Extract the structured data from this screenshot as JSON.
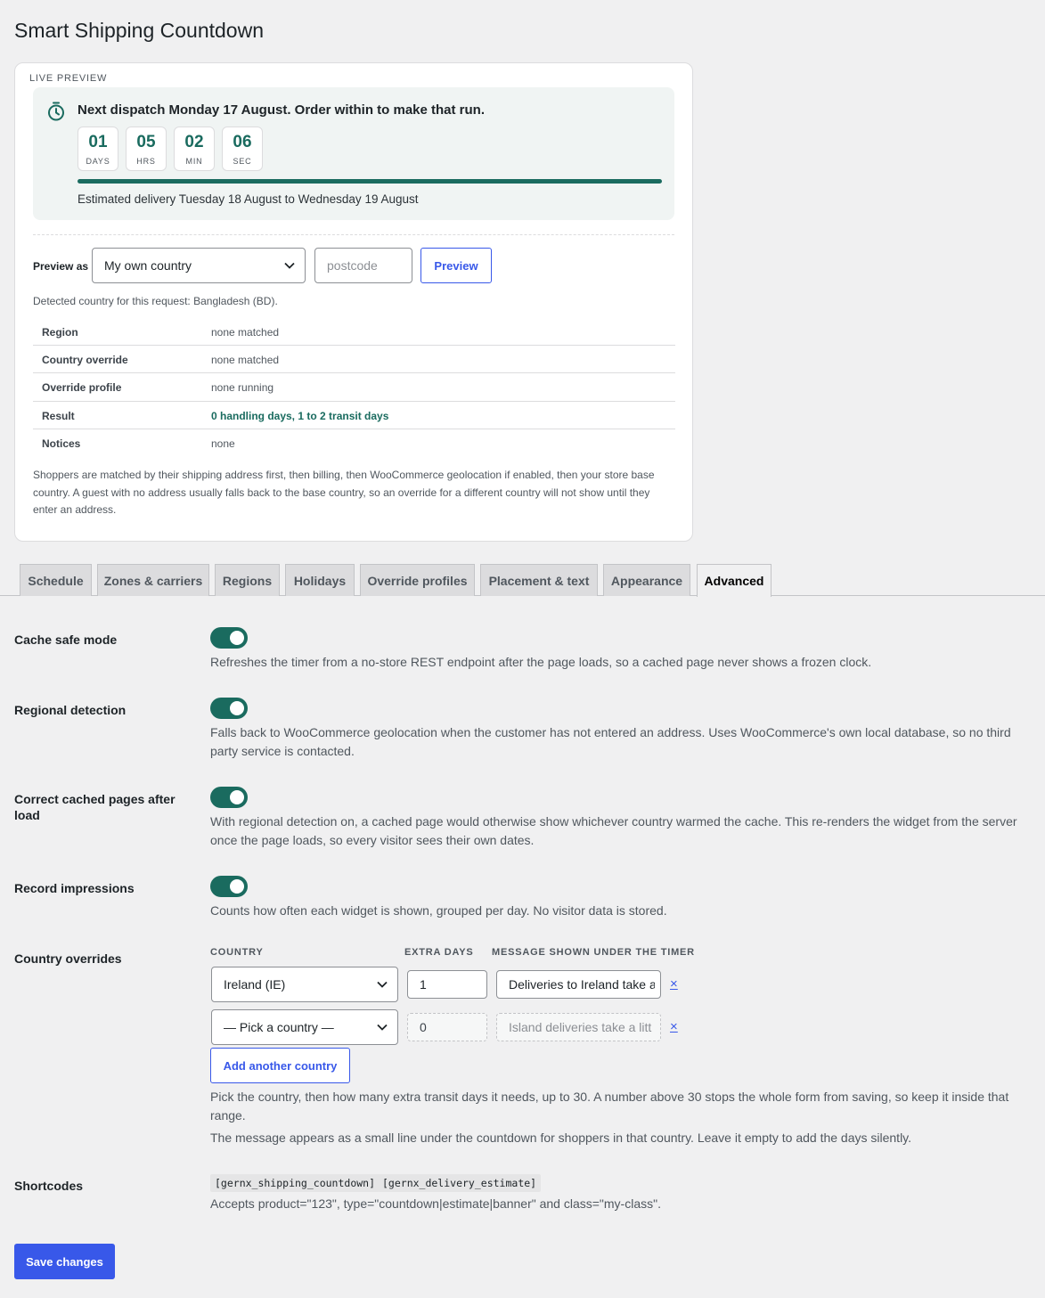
{
  "page": {
    "title": "Smart Shipping Countdown"
  },
  "preview": {
    "label": "LIVE PREVIEW",
    "headline": "Next dispatch Monday 17 August. Order within to make that run.",
    "units": [
      {
        "value": "01",
        "label": "DAYS"
      },
      {
        "value": "05",
        "label": "HRS"
      },
      {
        "value": "02",
        "label": "MIN"
      },
      {
        "value": "06",
        "label": "SEC"
      }
    ],
    "estimate": "Estimated delivery Tuesday 18 August to Wednesday 19 August",
    "preview_as_label": "Preview as",
    "country_select": "My own country",
    "postcode_placeholder": "postcode",
    "preview_button": "Preview",
    "detected": "Detected country for this request: Bangladesh (BD).",
    "diagnostics": [
      {
        "key": "Region",
        "value": "none matched"
      },
      {
        "key": "Country override",
        "value": "none matched"
      },
      {
        "key": "Override profile",
        "value": "none running"
      },
      {
        "key": "Result",
        "value": "0 handling days, 1 to 2 transit days"
      },
      {
        "key": "Notices",
        "value": "none"
      }
    ],
    "note": "Shoppers are matched by their shipping address first, then billing, then WooCommerce geolocation if enabled, then your store base country. A guest with no address usually falls back to the base country, so an override for a different country will not show until they enter an address."
  },
  "tabs": [
    "Schedule",
    "Zones & carriers",
    "Regions",
    "Holidays",
    "Override profiles",
    "Placement & text",
    "Appearance",
    "Advanced"
  ],
  "active_tab": "Advanced",
  "settings": {
    "cache_safe": {
      "label": "Cache safe mode",
      "enabled": true,
      "desc": "Refreshes the timer from a no-store REST endpoint after the page loads, so a cached page never shows a frozen clock."
    },
    "regional": {
      "label": "Regional detection",
      "enabled": true,
      "desc": "Falls back to WooCommerce geolocation when the customer has not entered an address. Uses WooCommerce's own local database, so no third party service is contacted."
    },
    "correct_cached": {
      "label": "Correct cached pages after load",
      "enabled": true,
      "desc": "With regional detection on, a cached page would otherwise show whichever country warmed the cache. This re-renders the widget from the server once the page loads, so every visitor sees their own dates."
    },
    "impressions": {
      "label": "Record impressions",
      "enabled": true,
      "desc": "Counts how often each widget is shown, grouped per day. No visitor data is stored."
    },
    "overrides": {
      "label": "Country overrides",
      "col_country": "COUNTRY",
      "col_days": "EXTRA DAYS",
      "col_message": "MESSAGE SHOWN UNDER THE TIMER",
      "rows": [
        {
          "country": "Ireland (IE)",
          "days": "1",
          "message": "Deliveries to Ireland take a",
          "remove": "×"
        },
        {
          "country": "— Pick a country —",
          "days": "0",
          "message": "Island deliveries take a litt",
          "remove": "×"
        }
      ],
      "add_button": "Add another country",
      "help1": "Pick the country, then how many extra transit days it needs, up to 30. A number above 30 stops the whole form from saving, so keep it inside that range.",
      "help2": "The message appears as a small line under the countdown for shoppers in that country. Leave it empty to add the days silently."
    },
    "shortcodes": {
      "label": "Shortcodes",
      "codes": [
        "[gernx_shipping_countdown]",
        "[gernx_delivery_estimate]"
      ],
      "desc": "Accepts product=\"123\", type=\"countdown|estimate|banner\" and class=\"my-class\"."
    }
  },
  "save_button": "Save changes",
  "colors": {
    "accent": "#3858e9",
    "brand_green": "#1a6b5f",
    "background": "#f0f0f1"
  }
}
